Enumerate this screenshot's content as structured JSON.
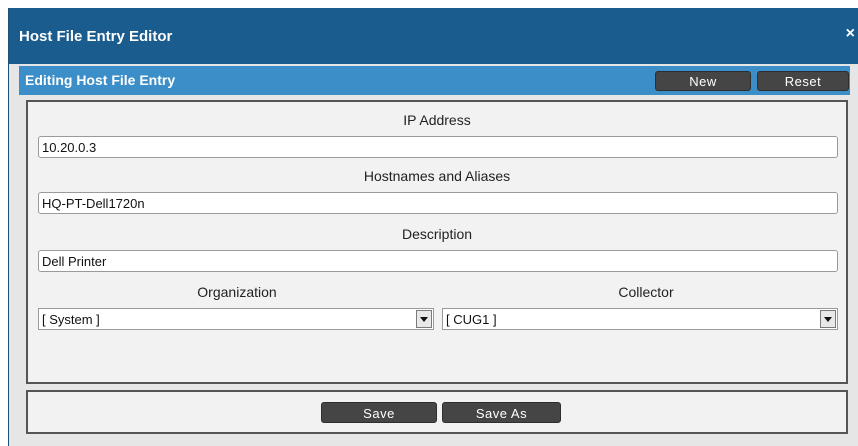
{
  "window": {
    "title": "Host File Entry Editor",
    "close_glyph": "×"
  },
  "subheader": {
    "title": "Editing Host File Entry",
    "new_label": "New",
    "reset_label": "Reset"
  },
  "form": {
    "ip_address": {
      "label": "IP Address",
      "value": "10.20.0.3"
    },
    "hostnames": {
      "label": "Hostnames and Aliases",
      "value": "HQ-PT-Dell1720n"
    },
    "description": {
      "label": "Description",
      "value": "Dell Printer"
    },
    "organization": {
      "label": "Organization",
      "value": "[ System ]"
    },
    "collector": {
      "label": "Collector",
      "value": "[ CUG1 ]"
    }
  },
  "footer": {
    "save_label": "Save",
    "save_as_label": "Save As"
  },
  "colors": {
    "titlebar": "#1b5c8e",
    "subheader": "#3b8ec8",
    "button": "#454545"
  },
  "icons": {
    "close": "close-icon",
    "dropdown": "chevron-down-icon"
  }
}
